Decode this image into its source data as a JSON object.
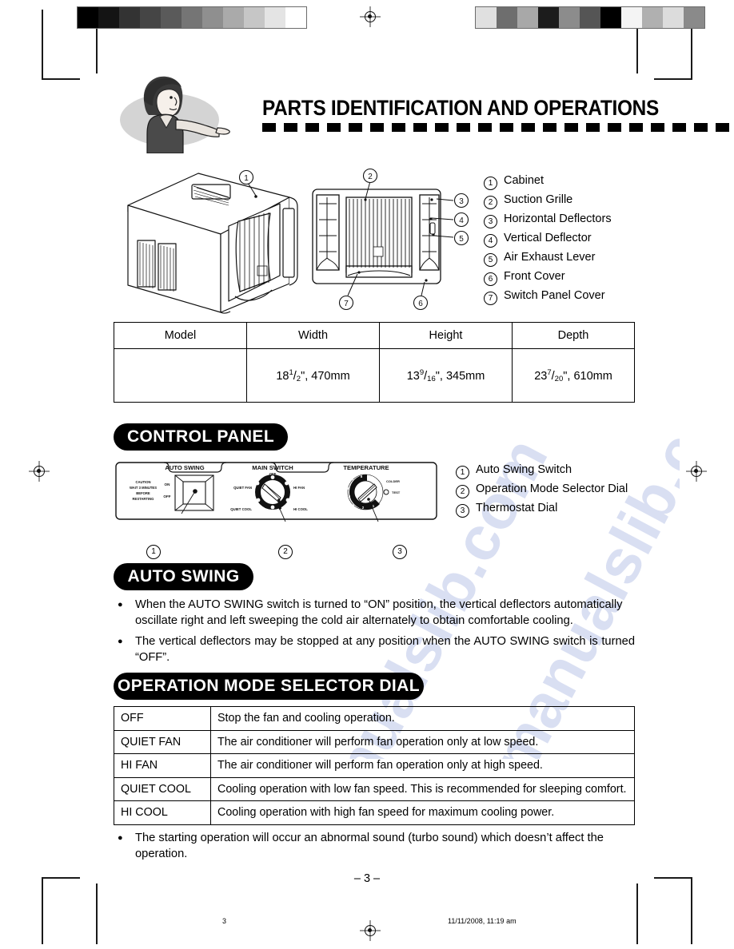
{
  "document": {
    "title": "PARTS IDENTIFICATION AND OPERATIONS",
    "page_number": "– 3 –",
    "footer_left": "3",
    "footer_right": "11/11/2008, 11:19 am",
    "watermark": "manualslib.com"
  },
  "calibration": {
    "left_bar": [
      "#000000",
      "#141414",
      "#333333",
      "#454545",
      "#5a5a5a",
      "#757575",
      "#8f8f8f",
      "#aaaaaa",
      "#c6c6c6",
      "#e4e4e4",
      "#ffffff"
    ],
    "right_bar": [
      "#e0e0e0",
      "#6e6e6e",
      "#a8a8a8",
      "#1c1c1c",
      "#8c8c8c",
      "#555555",
      "#000000",
      "#f4f4f4",
      "#b0b0b0",
      "#dcdcdc",
      "#8a8a8a"
    ]
  },
  "parts_list": {
    "items": [
      {
        "num": "1",
        "label": "Cabinet"
      },
      {
        "num": "2",
        "label": "Suction Grille"
      },
      {
        "num": "3",
        "label": "Horizontal Deflectors"
      },
      {
        "num": "4",
        "label": "Vertical Deflector"
      },
      {
        "num": "5",
        "label": "Air Exhaust Lever"
      },
      {
        "num": "6",
        "label": "Front Cover"
      },
      {
        "num": "7",
        "label": "Switch Panel Cover"
      }
    ]
  },
  "diagram_callouts": {
    "iso": [
      "1"
    ],
    "front": [
      "2",
      "3",
      "4",
      "5",
      "6",
      "7"
    ],
    "control_panel": [
      "1",
      "2",
      "3"
    ]
  },
  "dimension_table": {
    "headers": [
      "Model",
      "Width",
      "Height",
      "Depth"
    ],
    "row": {
      "model": "",
      "width": {
        "whole": "18",
        "numerator": "1",
        "denominator": "2",
        "unit": "\", 470mm"
      },
      "height": {
        "whole": "13",
        "numerator": "9",
        "denominator": "16",
        "unit": "\", 345mm"
      },
      "depth": {
        "whole": "23",
        "numerator": "7",
        "denominator": "20",
        "unit": "\", 610mm"
      }
    }
  },
  "control_panel": {
    "heading": "CONTROL PANEL",
    "sections": {
      "auto_swing_label": "AUTO SWING",
      "main_switch_label": "MAIN SWITCH",
      "temperature_label": "TEMPERATURE"
    },
    "caution_lines": [
      "CAUTION",
      "WAIT 3 MINUTES",
      "BEFORE",
      "RESTARTING"
    ],
    "swing_positions": [
      "ON",
      "OFF"
    ],
    "main_switch_positions": [
      "OFF",
      "QUIET FAN",
      "HI FAN",
      "QUIET COOL",
      "HI COOL"
    ],
    "thermostat_numbers": [
      "1",
      "2",
      "3",
      "4",
      "5",
      "6",
      "7",
      "8",
      "9"
    ],
    "thermostat_labels": [
      "COLDER",
      "TEST"
    ],
    "legend": [
      {
        "num": "1",
        "label": "Auto Swing Switch"
      },
      {
        "num": "2",
        "label": "Operation Mode Selector Dial"
      },
      {
        "num": "3",
        "label": "Thermostat Dial"
      }
    ]
  },
  "auto_swing": {
    "heading": "AUTO SWING",
    "bullets": [
      "When the AUTO SWING switch is turned to “ON” position, the vertical deflectors automatically oscillate right and left sweeping the cold air alternately to obtain comfortable cooling.",
      "The vertical deflectors may be stopped at any position when the AUTO SWING switch is turned “OFF”."
    ]
  },
  "operation_mode": {
    "heading": "OPERATION MODE SELECTOR DIAL",
    "rows": [
      {
        "mode": "OFF",
        "description": "Stop the fan and cooling operation."
      },
      {
        "mode": "QUIET FAN",
        "description": "The air conditioner will perform fan operation only at low speed."
      },
      {
        "mode": "HI FAN",
        "description": "The air conditioner will perform fan operation only at high speed."
      },
      {
        "mode": "QUIET COOL",
        "description": "Cooling operation with low fan speed. This is recommended for sleeping comfort."
      },
      {
        "mode": "HI COOL",
        "description": "Cooling operation with high fan speed for maximum cooling power."
      }
    ],
    "note": "The starting operation will occur an abnormal sound (turbo sound) which doesn’t affect the operation."
  }
}
